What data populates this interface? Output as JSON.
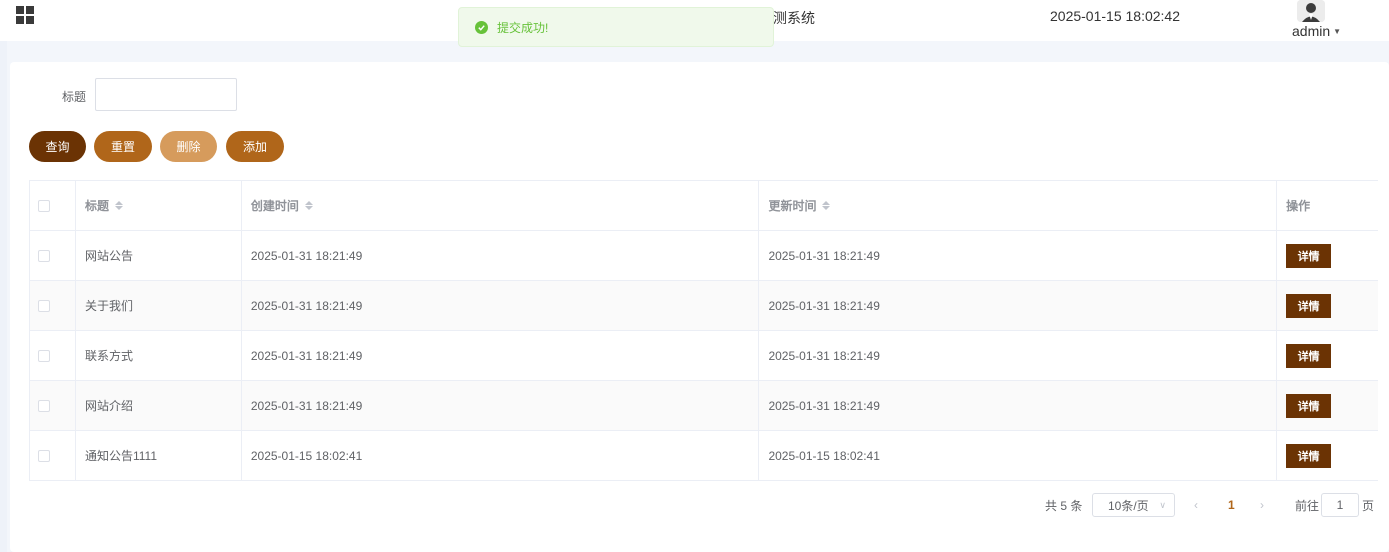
{
  "header": {
    "system_title": "测系统",
    "datetime": "2025-01-15 18:02:42",
    "username": "admin"
  },
  "toast": {
    "message": "提交成功!",
    "color": "#67c23a"
  },
  "search": {
    "label": "标题",
    "value": "",
    "placeholder": ""
  },
  "buttons": {
    "query": "查询",
    "reset": "重置",
    "delete": "删除",
    "add": "添加"
  },
  "colors": {
    "primary_dark": "#6b3304",
    "primary": "#b0661a",
    "primary_light": "#d69b5c"
  },
  "table": {
    "columns": [
      "标题",
      "创建时间",
      "更新时间",
      "操作"
    ],
    "action_label": "详情",
    "rows": [
      {
        "title": "网站公告",
        "created": "2025-01-31 18:21:49",
        "updated": "2025-01-31 18:21:49"
      },
      {
        "title": "关于我们",
        "created": "2025-01-31 18:21:49",
        "updated": "2025-01-31 18:21:49"
      },
      {
        "title": "联系方式",
        "created": "2025-01-31 18:21:49",
        "updated": "2025-01-31 18:21:49"
      },
      {
        "title": "网站介绍",
        "created": "2025-01-31 18:21:49",
        "updated": "2025-01-31 18:21:49"
      },
      {
        "title": "通知公告1111",
        "created": "2025-01-15 18:02:41",
        "updated": "2025-01-15 18:02:41"
      }
    ]
  },
  "pagination": {
    "total": "共 5 条",
    "page_size": "10条/页",
    "current_page": "1",
    "goto_label": "前往",
    "goto_value": "1",
    "suffix": "页"
  }
}
